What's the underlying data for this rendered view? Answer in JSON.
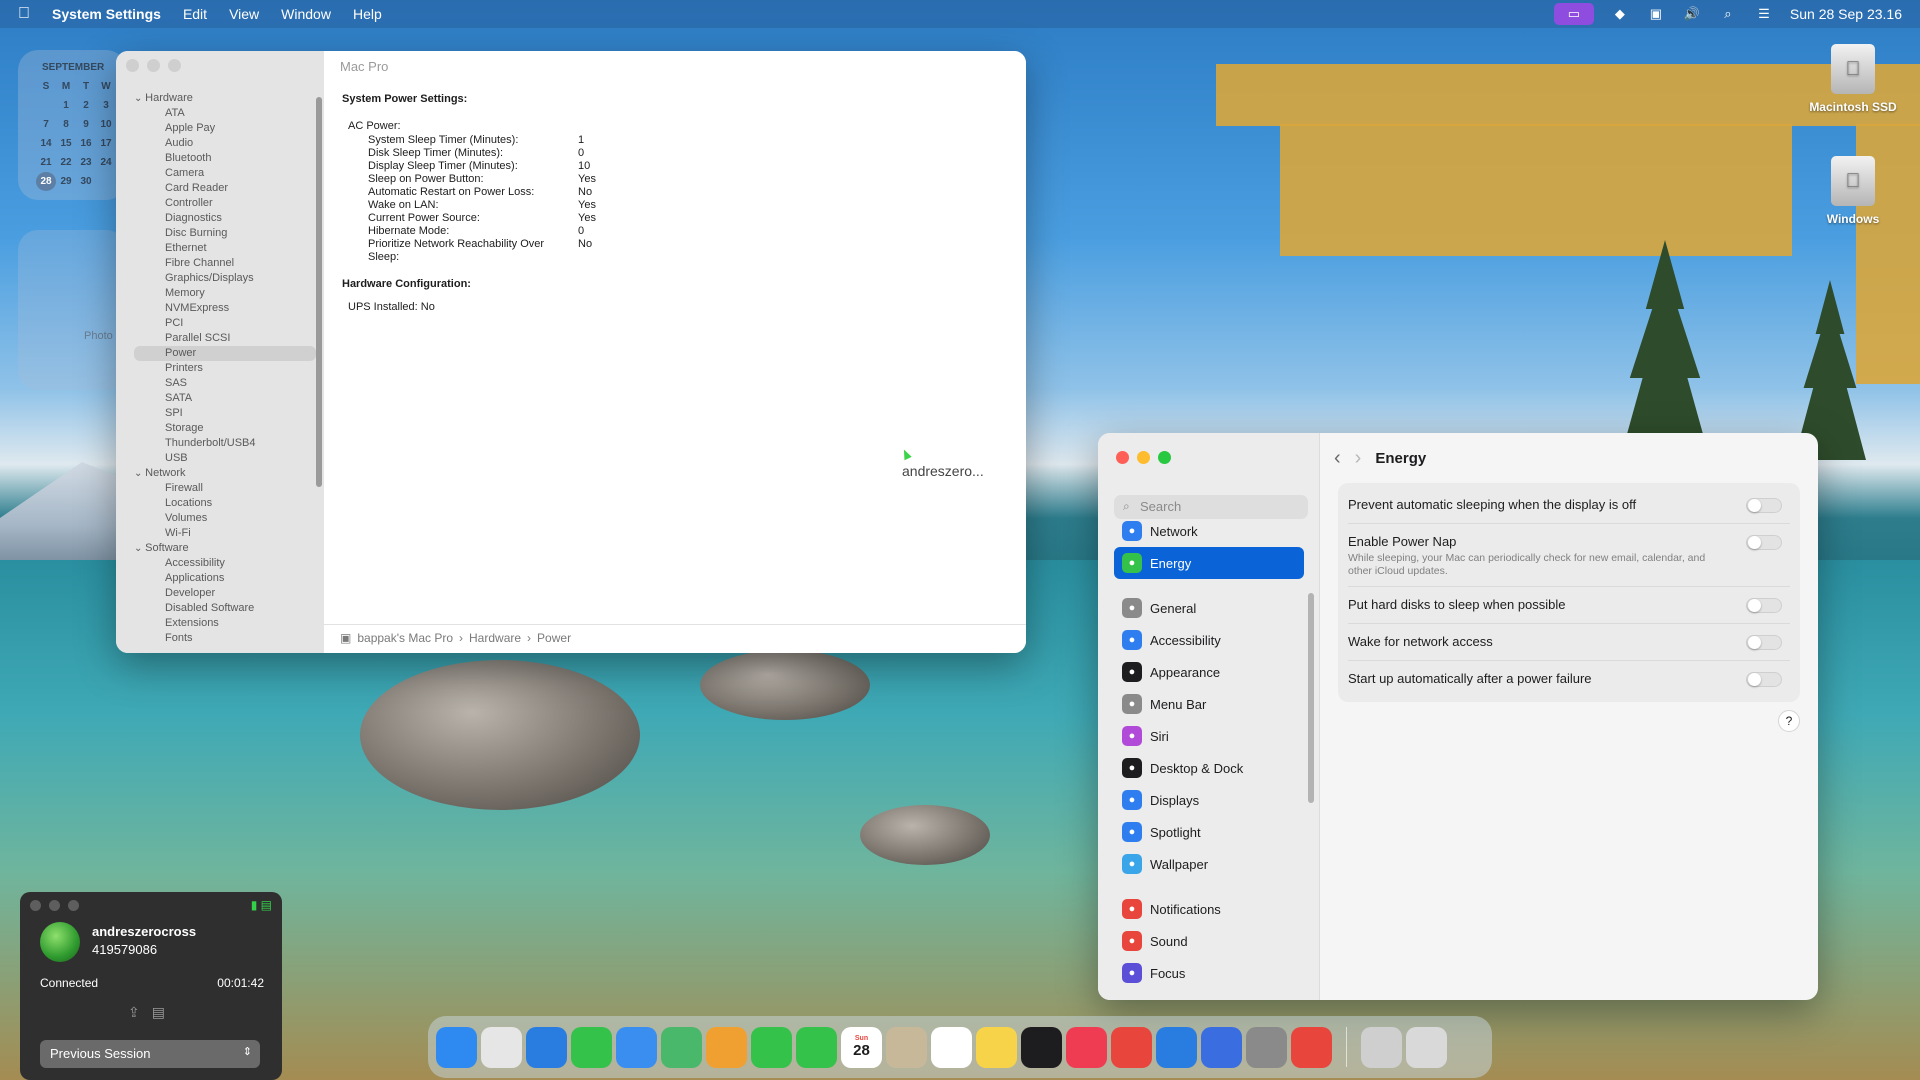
{
  "menubar": {
    "app": "System Settings",
    "items": [
      "Edit",
      "View",
      "Window",
      "Help"
    ],
    "datetime": "Sun 28 Sep  23.16"
  },
  "calendar": {
    "month": "SEPTEMBER",
    "weekdays": [
      "S",
      "M",
      "T",
      "W"
    ],
    "rows": [
      [
        "",
        "1",
        "2",
        "3"
      ],
      [
        "7",
        "8",
        "9",
        "10"
      ],
      [
        "14",
        "15",
        "16",
        "17"
      ],
      [
        "21",
        "22",
        "23",
        "24"
      ],
      [
        "28",
        "29",
        "30",
        ""
      ]
    ],
    "today": "28"
  },
  "photo_widget": {
    "label": "Photo"
  },
  "sysinfo": {
    "title": "Mac Pro",
    "tree": [
      {
        "label": "Hardware",
        "group": true
      },
      {
        "label": "ATA"
      },
      {
        "label": "Apple Pay"
      },
      {
        "label": "Audio"
      },
      {
        "label": "Bluetooth"
      },
      {
        "label": "Camera"
      },
      {
        "label": "Card Reader"
      },
      {
        "label": "Controller"
      },
      {
        "label": "Diagnostics"
      },
      {
        "label": "Disc Burning"
      },
      {
        "label": "Ethernet"
      },
      {
        "label": "Fibre Channel"
      },
      {
        "label": "Graphics/Displays"
      },
      {
        "label": "Memory"
      },
      {
        "label": "NVMExpress"
      },
      {
        "label": "PCI"
      },
      {
        "label": "Parallel SCSI"
      },
      {
        "label": "Power",
        "selected": true
      },
      {
        "label": "Printers"
      },
      {
        "label": "SAS"
      },
      {
        "label": "SATA"
      },
      {
        "label": "SPI"
      },
      {
        "label": "Storage"
      },
      {
        "label": "Thunderbolt/USB4"
      },
      {
        "label": "USB"
      },
      {
        "label": "Network",
        "group": true
      },
      {
        "label": "Firewall"
      },
      {
        "label": "Locations"
      },
      {
        "label": "Volumes"
      },
      {
        "label": "Wi-Fi"
      },
      {
        "label": "Software",
        "group": true
      },
      {
        "label": "Accessibility"
      },
      {
        "label": "Applications"
      },
      {
        "label": "Developer"
      },
      {
        "label": "Disabled Software"
      },
      {
        "label": "Extensions"
      },
      {
        "label": "Fonts"
      }
    ],
    "power_heading": "System Power Settings:",
    "ac_label": "AC Power:",
    "settings": [
      {
        "k": "System Sleep Timer (Minutes):",
        "v": "1"
      },
      {
        "k": "Disk Sleep Timer (Minutes):",
        "v": "0"
      },
      {
        "k": "Display Sleep Timer (Minutes):",
        "v": "10"
      },
      {
        "k": "Sleep on Power Button:",
        "v": "Yes"
      },
      {
        "k": "Automatic Restart on Power Loss:",
        "v": "No"
      },
      {
        "k": "Wake on LAN:",
        "v": "Yes"
      },
      {
        "k": "Current Power Source:",
        "v": "Yes"
      },
      {
        "k": "Hibernate Mode:",
        "v": "0"
      },
      {
        "k": "Prioritize Network Reachability Over Sleep:",
        "v": "No"
      }
    ],
    "hw_heading": "Hardware Configuration:",
    "ups": "UPS Installed:  No",
    "breadcrumb": [
      "bappak's Mac Pro",
      "Hardware",
      "Power"
    ],
    "cursor_label": "andreszero..."
  },
  "settings": {
    "search_placeholder": "Search",
    "title": "Energy",
    "nav": [
      {
        "label": "Network",
        "color": "#2f7ef0",
        "icon": "globe-icon"
      },
      {
        "label": "Energy",
        "color": "#35c24a",
        "icon": "bolt-icon",
        "selected": true
      },
      {
        "gap": true
      },
      {
        "label": "General",
        "color": "#8a8a8a",
        "icon": "gear-icon"
      },
      {
        "label": "Accessibility",
        "color": "#2f7ef0",
        "icon": "accessibility-icon"
      },
      {
        "label": "Appearance",
        "color": "#1d1d1f",
        "icon": "appearance-icon"
      },
      {
        "label": "Menu Bar",
        "color": "#8a8a8a",
        "icon": "menubar-icon"
      },
      {
        "label": "Siri",
        "color": "#b14ad8",
        "icon": "siri-icon"
      },
      {
        "label": "Desktop & Dock",
        "color": "#1d1d1f",
        "icon": "dock-icon"
      },
      {
        "label": "Displays",
        "color": "#2f7ef0",
        "icon": "display-icon"
      },
      {
        "label": "Spotlight",
        "color": "#2f7ef0",
        "icon": "spotlight-icon"
      },
      {
        "label": "Wallpaper",
        "color": "#3aa5e8",
        "icon": "wallpaper-icon"
      },
      {
        "gap": true
      },
      {
        "label": "Notifications",
        "color": "#e8453c",
        "icon": "bell-icon"
      },
      {
        "label": "Sound",
        "color": "#e8453c",
        "icon": "speaker-icon"
      },
      {
        "label": "Focus",
        "color": "#5a4fd6",
        "icon": "moon-icon"
      }
    ],
    "options": [
      {
        "label": "Prevent automatic sleeping when the display is off",
        "on": false
      },
      {
        "label": "Enable Power Nap",
        "desc": "While sleeping, your Mac can periodically check for new email, calendar, and other iCloud updates.",
        "on": false
      },
      {
        "label": "Put hard disks to sleep when possible",
        "on": false
      },
      {
        "label": "Wake for network access",
        "on": false
      },
      {
        "label": "Start up automatically after a power failure",
        "on": false
      }
    ],
    "help": "?"
  },
  "remote": {
    "name": "andreszerocross",
    "id": "419579086",
    "status": "Connected",
    "timer": "00:01:42",
    "session_select": "Previous Session"
  },
  "desktop_icons": [
    {
      "label": "Macintosh SSD"
    },
    {
      "label": "Windows"
    }
  ],
  "dock": {
    "calendar_day": "28",
    "calendar_month": "Sun",
    "apps": [
      {
        "name": "finder",
        "color": "#2e8af0"
      },
      {
        "name": "launchpad",
        "color": "#e6e6e6"
      },
      {
        "name": "safari",
        "color": "#2a7de0"
      },
      {
        "name": "messages",
        "color": "#35c24a"
      },
      {
        "name": "mail",
        "color": "#3a8ef0"
      },
      {
        "name": "maps",
        "color": "#49b86a"
      },
      {
        "name": "photos",
        "color": "#f0a030"
      },
      {
        "name": "facetime",
        "color": "#35c24a"
      },
      {
        "name": "phone",
        "color": "#35c24a"
      },
      {
        "name": "calendar",
        "color": "#ffffff"
      },
      {
        "name": "contacts",
        "color": "#c8b89a"
      },
      {
        "name": "reminders",
        "color": "#ffffff"
      },
      {
        "name": "notes",
        "color": "#f7d34a"
      },
      {
        "name": "tv",
        "color": "#1d1d1f"
      },
      {
        "name": "music",
        "color": "#f03c52"
      },
      {
        "name": "rocket",
        "color": "#e8453c"
      },
      {
        "name": "app-store",
        "color": "#2a7de0"
      },
      {
        "name": "xcode",
        "color": "#3a6ee0"
      },
      {
        "name": "system-settings",
        "color": "#8a8a8a"
      },
      {
        "name": "anydesk",
        "color": "#e8453c"
      },
      {
        "name": "preview",
        "color": "#cfcfcf"
      }
    ]
  }
}
